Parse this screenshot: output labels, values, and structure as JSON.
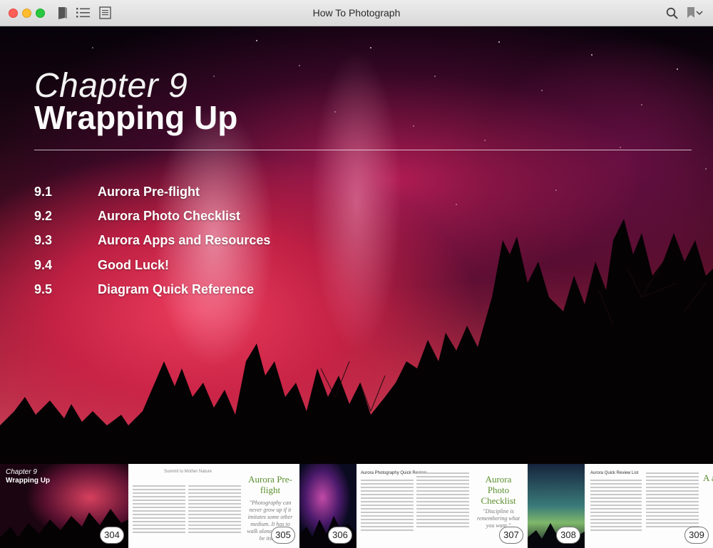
{
  "window": {
    "title": "How To Photograph"
  },
  "toolbar": {
    "icons": [
      "library-icon",
      "toc-list-icon",
      "notes-icon",
      "search-icon",
      "bookmark-icon",
      "chevron-down-icon"
    ]
  },
  "chapter": {
    "label": "Chapter 9",
    "title": "Wrapping Up"
  },
  "toc": [
    {
      "number": "9.1",
      "title": "Aurora Pre-flight"
    },
    {
      "number": "9.2",
      "title": "Aurora Photo Checklist"
    },
    {
      "number": "9.3",
      "title": "Aurora Apps and Resources"
    },
    {
      "number": "9.4",
      "title": "Good Luck!"
    },
    {
      "number": "9.5",
      "title": "Diagram Quick Reference"
    }
  ],
  "pages": [
    {
      "number": "304",
      "mini_label": "Chapter 9",
      "mini_title": "Wrapping Up"
    },
    {
      "number": "305",
      "heading": "Summit to Mother Nature",
      "green_title": "Aurora Pre-flight",
      "quote": "\"Photography can never grow up if it imitates some other medium. It has to walk alone; it has to be itself.\""
    },
    {
      "number": "306"
    },
    {
      "number": "307",
      "heading": "Aurora Photography Quick Review",
      "green_title": "Aurora Photo Checklist",
      "quote": "\"Discipline is remembering what you want.\""
    },
    {
      "number": "308"
    },
    {
      "number": "309",
      "heading": "Aurora Quick Review List",
      "green_title": "A an"
    }
  ],
  "colors": {
    "titlebar": "#e2e2e2",
    "accent_green": "#5a8f2c",
    "close": "#fe5f57",
    "minimize": "#febc2e",
    "maximize": "#28c840"
  }
}
